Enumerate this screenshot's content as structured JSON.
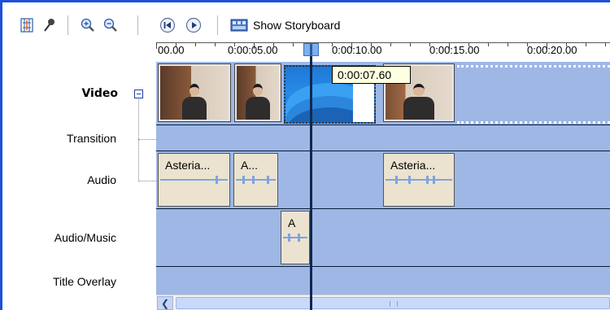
{
  "toolbar": {
    "storyboard_label": "Show Storyboard",
    "icons": [
      "timeline-settings-icon",
      "narrate-icon",
      "zoom-in-icon",
      "zoom-out-icon",
      "rewind-icon",
      "play-icon",
      "storyboard-icon"
    ]
  },
  "ruler": {
    "ticks": [
      "00.00",
      "0:00:05.00",
      "0:00:10.00",
      "0:00:15.00",
      "0:00:20.00"
    ]
  },
  "playhead": {
    "time": "0:00:07.60"
  },
  "tracks": {
    "video": "Video",
    "transition": "Transition",
    "audio": "Audio",
    "audio_music": "Audio/Music",
    "title_overlay": "Title Overlay"
  },
  "audio_clips": [
    "Asteria...",
    "A...",
    "Asteria..."
  ],
  "music_clips": [
    "A"
  ],
  "colors": {
    "accent": "#1d4fd8",
    "track_background": "#9eb7e5",
    "tooltip_background": "#ffffe1"
  }
}
